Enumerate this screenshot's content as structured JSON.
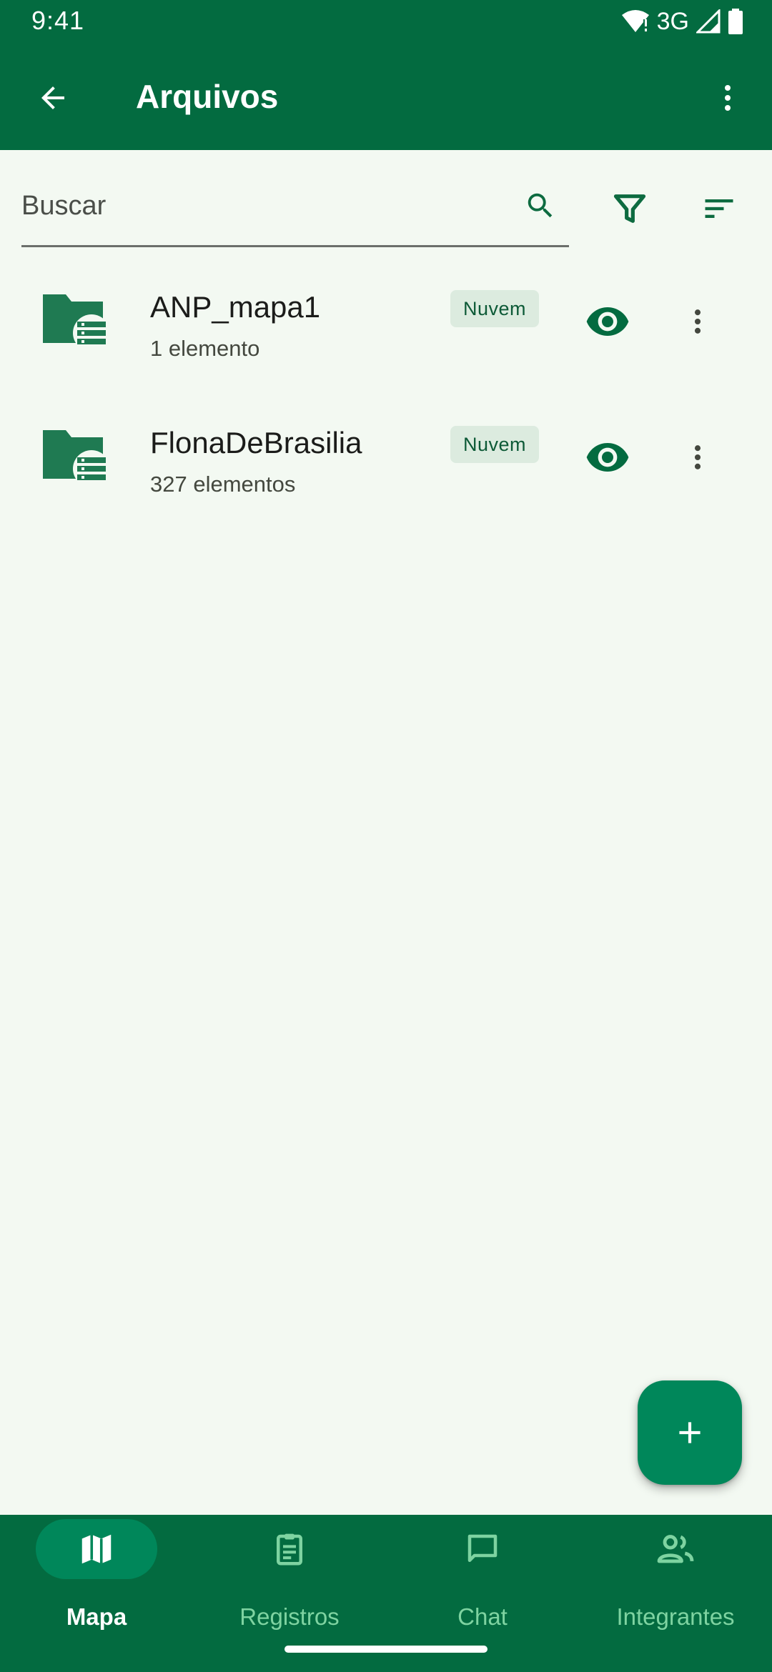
{
  "status_bar": {
    "time": "9:41",
    "network": "3G"
  },
  "app_bar": {
    "title": "Arquivos",
    "back_icon": "arrow-back-icon",
    "overflow_icon": "more-vert-icon"
  },
  "search": {
    "placeholder": "Buscar",
    "value": ""
  },
  "files": [
    {
      "name": "ANP_mapa1",
      "count": "1 elemento",
      "badge": "Nuvem"
    },
    {
      "name": "FlonaDeBrasilia",
      "count": "327 elementos",
      "badge": "Nuvem"
    }
  ],
  "bottom_nav": {
    "items": [
      {
        "label": "Mapa",
        "icon": "map-icon",
        "active": true
      },
      {
        "label": "Registros",
        "icon": "clipboard-icon",
        "active": false
      },
      {
        "label": "Chat",
        "icon": "chat-icon",
        "active": false
      },
      {
        "label": "Integrantes",
        "icon": "people-icon",
        "active": false
      }
    ]
  },
  "colors": {
    "primary_dark": "#036b40",
    "accent": "#00875a",
    "background": "#f3f9f2",
    "badge_bg": "#dcebdf",
    "nav_inactive": "#7ed3a1"
  }
}
